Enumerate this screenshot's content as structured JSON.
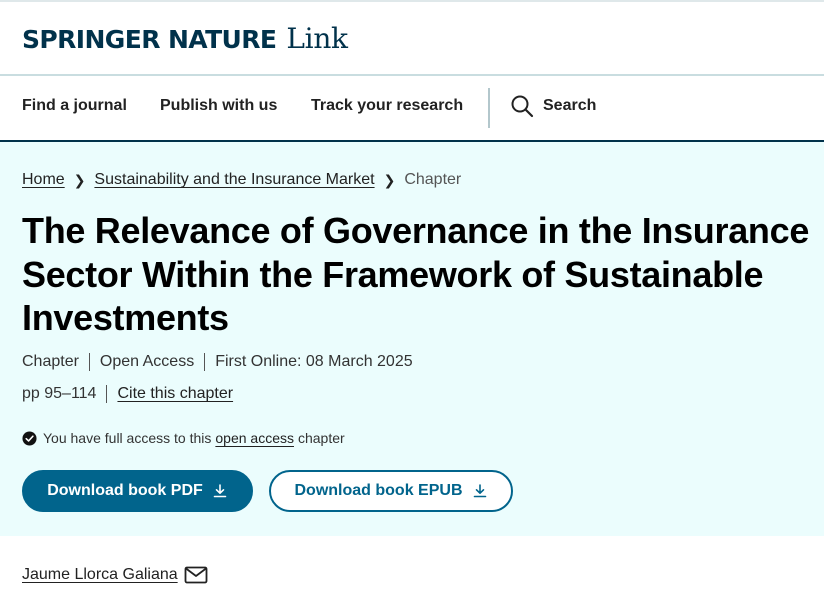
{
  "brand": {
    "main": "SPRINGER NATURE",
    "sub": "Link"
  },
  "nav": {
    "items": [
      {
        "label": "Find a journal"
      },
      {
        "label": "Publish with us"
      },
      {
        "label": "Track your research"
      }
    ],
    "search_label": "Search",
    "search_icon": "search-icon"
  },
  "breadcrumb": {
    "items": [
      {
        "label": "Home"
      },
      {
        "label": "Sustainability and the Insurance Market"
      },
      {
        "label": "Chapter"
      }
    ],
    "separator_icon": "chevron-right-icon"
  },
  "article": {
    "title": "The Relevance of Governance in the Insurance Sector Within the Framework of Sustainable Investments",
    "meta_line1": [
      "Chapter",
      "Open Access",
      "First Online: 08 March 2025"
    ],
    "pages": "pp 95–114",
    "cite_label": "Cite this chapter",
    "access": {
      "prefix": "You have full access to this",
      "link": "open access",
      "suffix": "chapter",
      "icon": "check-circle-icon"
    }
  },
  "buttons": {
    "pdf_label": "Download book PDF",
    "epub_label": "Download book EPUB",
    "icon": "download-icon"
  },
  "author": {
    "name": "Jaume Llorca Galiana",
    "icon": "mail-icon"
  },
  "colors": {
    "brand": "#01324b",
    "accent": "#01648c",
    "hero_bg": "#ebfdfd",
    "text": "#222222"
  }
}
